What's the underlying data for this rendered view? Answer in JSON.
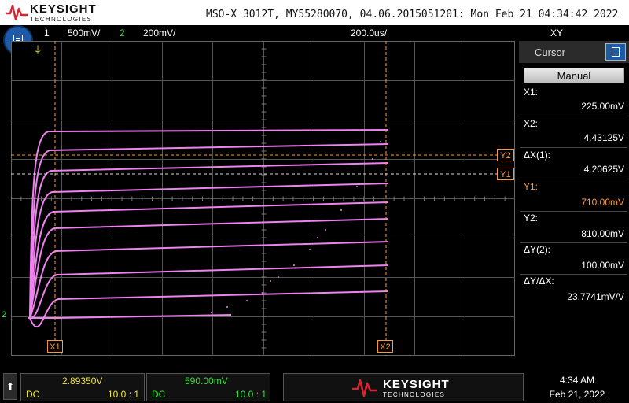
{
  "header": {
    "brand": "KEYSIGHT",
    "brand_sub": "TECHNOLOGIES",
    "device_info": "MSO-X 3012T, MY55280070, 04.06.2015051201: Mon Feb 21 04:34:42 2022"
  },
  "channels": {
    "ch1_num": "1",
    "ch1_scale": "500mV/",
    "ch2_num": "2",
    "ch2_scale": "200mV/",
    "timebase": "200.0us/",
    "mode": "XY"
  },
  "cursor_panel": {
    "title": "Cursor",
    "mode": "Manual",
    "x1_label": "X1:",
    "x1_value": "225.00mV",
    "x2_label": "X2:",
    "x2_value": "4.43125V",
    "dx_label": "ΔX(1):",
    "dx_value": "4.20625V",
    "y1_label": "Y1:",
    "y1_value": "710.00mV",
    "y2_label": "Y2:",
    "y2_value": "810.00mV",
    "dy_label": "ΔY(2):",
    "dy_value": "100.00mV",
    "dydx_label": "ΔY/ΔX:",
    "dydx_value": "23.7741mV/V"
  },
  "markers": {
    "x1": "X1",
    "x2": "X2",
    "y1": "Y1",
    "y2": "Y2",
    "ch2_ground": "2"
  },
  "bottom": {
    "ch1_value": "2.89350V",
    "ch1_coupling": "DC",
    "ch1_probe": "10.0 : 1",
    "ch2_value": "590.00mV",
    "ch2_coupling": "DC",
    "ch2_probe": "10.0 : 1",
    "brand": "KEYSIGHT",
    "brand_sub": "TECHNOLOGIES",
    "time": "4:34 AM",
    "date": "Feb 21, 2022"
  },
  "colors": {
    "ch1": "#f0e442",
    "ch2": "#3ddc3d",
    "trace": "#ee82ee",
    "cursor": "#ff9933",
    "y1_text": "#ff9933",
    "accent": "#1e5aa8",
    "brand_red": "#d22630"
  }
}
